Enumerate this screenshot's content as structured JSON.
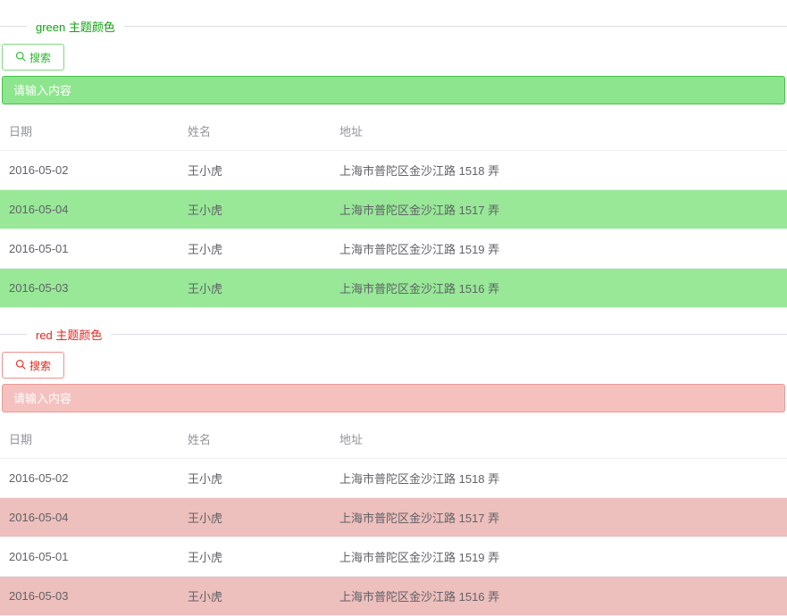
{
  "themes": [
    {
      "id": "green",
      "legend": "green 主题颜色"
    },
    {
      "id": "red",
      "legend": "red 主题颜色"
    }
  ],
  "search_button_label": "搜索",
  "input_placeholder": "请输入内容",
  "table": {
    "headers": {
      "date": "日期",
      "name": "姓名",
      "address": "地址"
    },
    "rows": [
      {
        "date": "2016-05-02",
        "name": "王小虎",
        "address": "上海市普陀区金沙江路 1518 弄",
        "striped": false
      },
      {
        "date": "2016-05-04",
        "name": "王小虎",
        "address": "上海市普陀区金沙江路 1517 弄",
        "striped": true
      },
      {
        "date": "2016-05-01",
        "name": "王小虎",
        "address": "上海市普陀区金沙江路 1519 弄",
        "striped": false
      },
      {
        "date": "2016-05-03",
        "name": "王小虎",
        "address": "上海市普陀区金沙江路 1516 弄",
        "striped": true
      }
    ]
  }
}
